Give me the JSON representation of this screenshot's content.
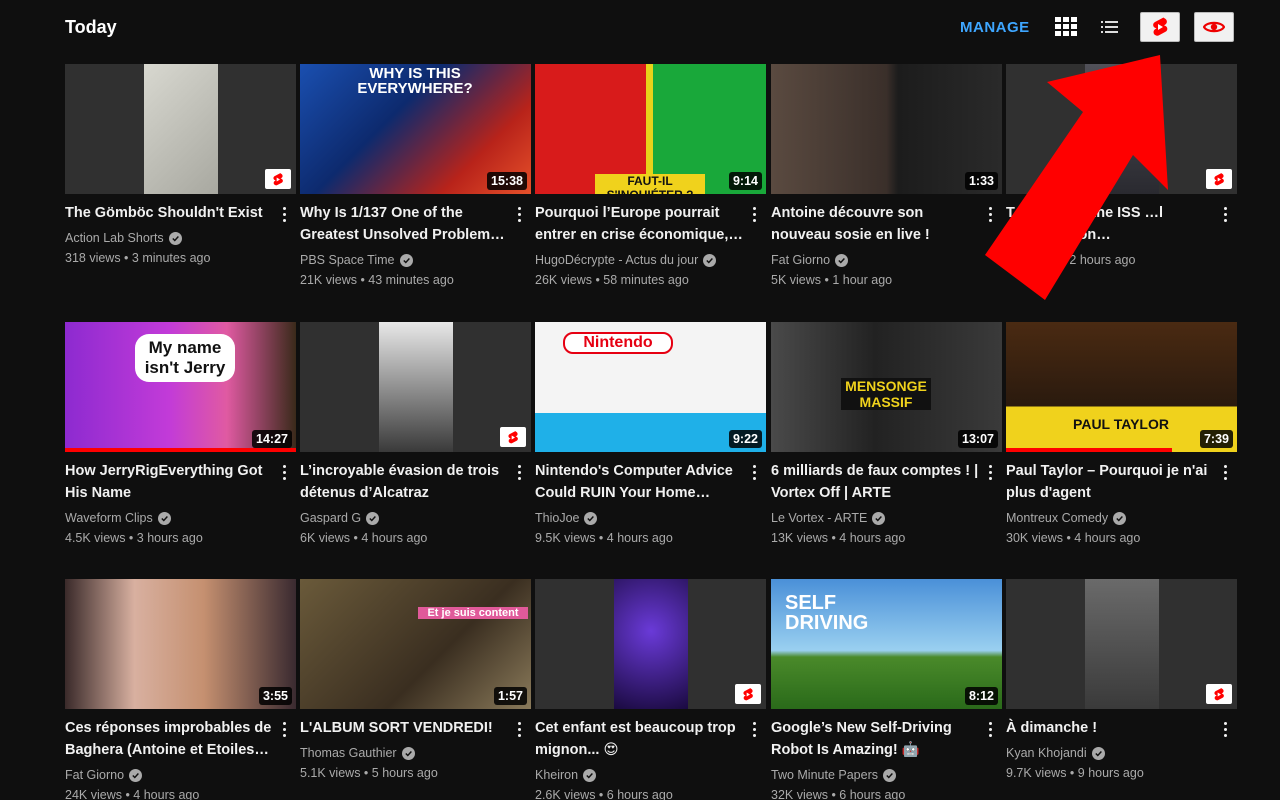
{
  "header": {
    "section_title": "Today",
    "manage_label": "MANAGE",
    "grid_icon": "grid-view-icon",
    "list_icon": "list-view-icon",
    "shorts_icon": "shorts-icon",
    "watched_icon": "eye-icon"
  },
  "colors": {
    "accent": "#3ea6ff",
    "shorts_red": "#ff0000",
    "background": "#0f0f0f",
    "meta_text": "#aaaaaa"
  },
  "videos": [
    {
      "title": "The Gömböc Shouldn't Exist",
      "channel": "Action Lab Shorts",
      "stats": "318 views • 3 minutes ago",
      "is_short": true
    },
    {
      "title": "Why Is 1/137 One of the Greatest Unsolved Problem…",
      "channel": "PBS Space Time",
      "stats": "21K views • 43 minutes ago",
      "duration": "15:38",
      "thumb_text": "WHY IS THIS EVERYWHERE?"
    },
    {
      "title": "Pourquoi l’Europe pourrait entrer en crise économique,…",
      "channel": "HugoDécrypte - Actus du jour",
      "stats": "26K views • 58 minutes ago",
      "duration": "9:14",
      "thumb_text": "FAUT-IL S'INQUIÉTER ?"
    },
    {
      "title": "Antoine découvre son nouveau sosie en live !",
      "channel": "Fat Giorno",
      "stats": "5K views • 1 hour ago",
      "duration": "1:33"
    },
    {
      "title": "T… …nts of the ISS …l Spacestation…",
      "channel": "",
      "stats": "2.1… …s • 2 hours ago",
      "is_short": true
    },
    {
      "title": "How JerryRigEverything Got His Name",
      "channel": "Waveform Clips",
      "stats": "4.5K views • 3 hours ago",
      "duration": "14:27",
      "progress": 1.0,
      "thumb_text": "My name isn't Jerry"
    },
    {
      "title": "L’incroyable évasion de trois détenus d’Alcatraz",
      "channel": "Gaspard G",
      "stats": "6K views • 4 hours ago",
      "is_short": true
    },
    {
      "title": "Nintendo's Computer Advice Could RUIN Your Home…",
      "channel": "ThioJoe",
      "stats": "9.5K views • 4 hours ago",
      "duration": "9:22",
      "thumb_text": "Nintendo"
    },
    {
      "title": "6 milliards de faux comptes ! | Vortex Off | ARTE",
      "channel": "Le Vortex - ARTE",
      "stats": "13K views • 4 hours ago",
      "duration": "13:07",
      "thumb_text": "MENSONGE MASSIF"
    },
    {
      "title": "Paul Taylor – Pourquoi je n'ai plus d'agent",
      "channel": "Montreux Comedy",
      "stats": "30K views • 4 hours ago",
      "duration": "7:39",
      "progress": 0.72,
      "thumb_text": "PAUL TAYLOR"
    },
    {
      "title": "Ces réponses improbables de Baghera (Antoine et Etoiles…",
      "channel": "Fat Giorno",
      "stats": "24K views • 4 hours ago",
      "duration": "3:55"
    },
    {
      "title": "L'ALBUM SORT VENDREDI!",
      "channel": "Thomas Gauthier",
      "stats": "5.1K views • 5 hours ago",
      "duration": "1:57",
      "thumb_text": "Et je suis content"
    },
    {
      "title": "Cet enfant est beaucoup trop mignon... 😍",
      "channel": "Kheiron",
      "stats": "2.6K views • 6 hours ago",
      "is_short": true
    },
    {
      "title": "Google’s New Self-Driving Robot Is Amazing! 🤖",
      "channel": "Two Minute Papers",
      "stats": "32K views • 6 hours ago",
      "duration": "8:12",
      "thumb_text": "SELF DRIVING"
    },
    {
      "title": "À dimanche !",
      "channel": "Kyan Khojandi",
      "stats": "9.7K views • 9 hours ago",
      "is_short": true
    }
  ]
}
